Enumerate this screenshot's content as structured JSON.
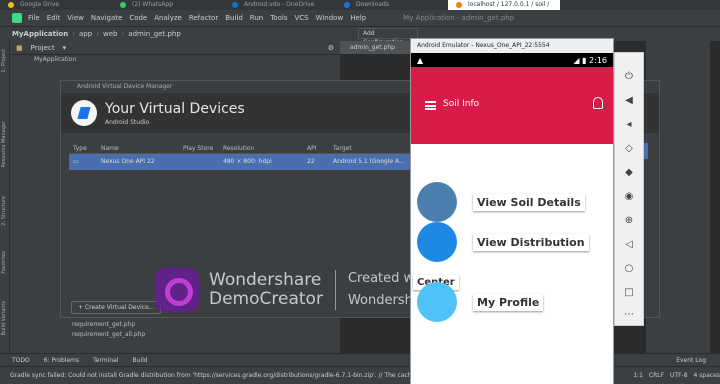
{
  "browser_tabs": [
    {
      "label": "Google Drive",
      "color": "#fbbc04"
    },
    {
      "label": "(2) WhatsApp",
      "color": "#25d366"
    },
    {
      "label": "Android.vdo - OneDrive",
      "color": "#0078d4"
    },
    {
      "label": "Downloads",
      "color": "#1a73e8"
    },
    {
      "label": "localhost / 127.0.0.1 / soil /",
      "color": "#f57c00"
    }
  ],
  "menu": [
    "File",
    "Edit",
    "View",
    "Navigate",
    "Code",
    "Analyze",
    "Refactor",
    "Build",
    "Run",
    "Tools",
    "VCS",
    "Window",
    "Help"
  ],
  "window_title": "My Application - admin_get.php",
  "breadcrumb": [
    "MyApplication",
    "app",
    "web",
    "admin_get.php"
  ],
  "add_config": "Add Configuration...",
  "project_label": "Project",
  "tree_root": "MyApplication",
  "editor_tab": "admin_get.php",
  "side_tabs": [
    "1: Project",
    "Resource Manager",
    "2: Structure",
    "Favorites",
    "Build Variants"
  ],
  "avd": {
    "window_title": "Android Virtual Device Manager",
    "heading": "Your Virtual Devices",
    "subheading": "Android Studio",
    "columns": [
      "Type",
      "Name",
      "Play Store",
      "Resolution",
      "API",
      "Target"
    ],
    "row": {
      "name": "Nexus One API 22",
      "play_store": "",
      "resolution": "480 × 800: hdpi",
      "api": "22",
      "target": "Android 5.1 (Google A..."
    },
    "create_button": "+ Create Virtual Device..."
  },
  "watermark": {
    "brand_line1": "Wondershare",
    "brand_line2": "DemoCreator",
    "created_with": "Created with",
    "created_by": "Wondershare DemoCreator"
  },
  "code_files": [
    "requirement_get.php",
    "requirement_get_all.php"
  ],
  "tool_windows": [
    "TODO",
    "6: Problems",
    "Terminal",
    "Build"
  ],
  "status_message": "Gradle sync failed: Could not install Gradle distribution from 'https://services.gradle.org/distributions/gradle-6.7.1-bin.zip'. // The cached",
  "status_right": [
    "1:1",
    "CRLF",
    "UTF-8",
    "4 spaces"
  ],
  "event_log": "Event Log",
  "emulator": {
    "title": "Android Emulator - Nexus_One_API_22:5554",
    "time": "2:16",
    "app_title": "Soil Info",
    "items": [
      {
        "label": "View Soil Details",
        "icon": "soil-hand-icon"
      },
      {
        "label": "View Distribution",
        "icon": "truck-icon"
      },
      {
        "label": "My Profile",
        "icon": "profile-icon"
      }
    ],
    "center_label": "Center",
    "colors": {
      "app_bar": "#d81b47"
    }
  }
}
